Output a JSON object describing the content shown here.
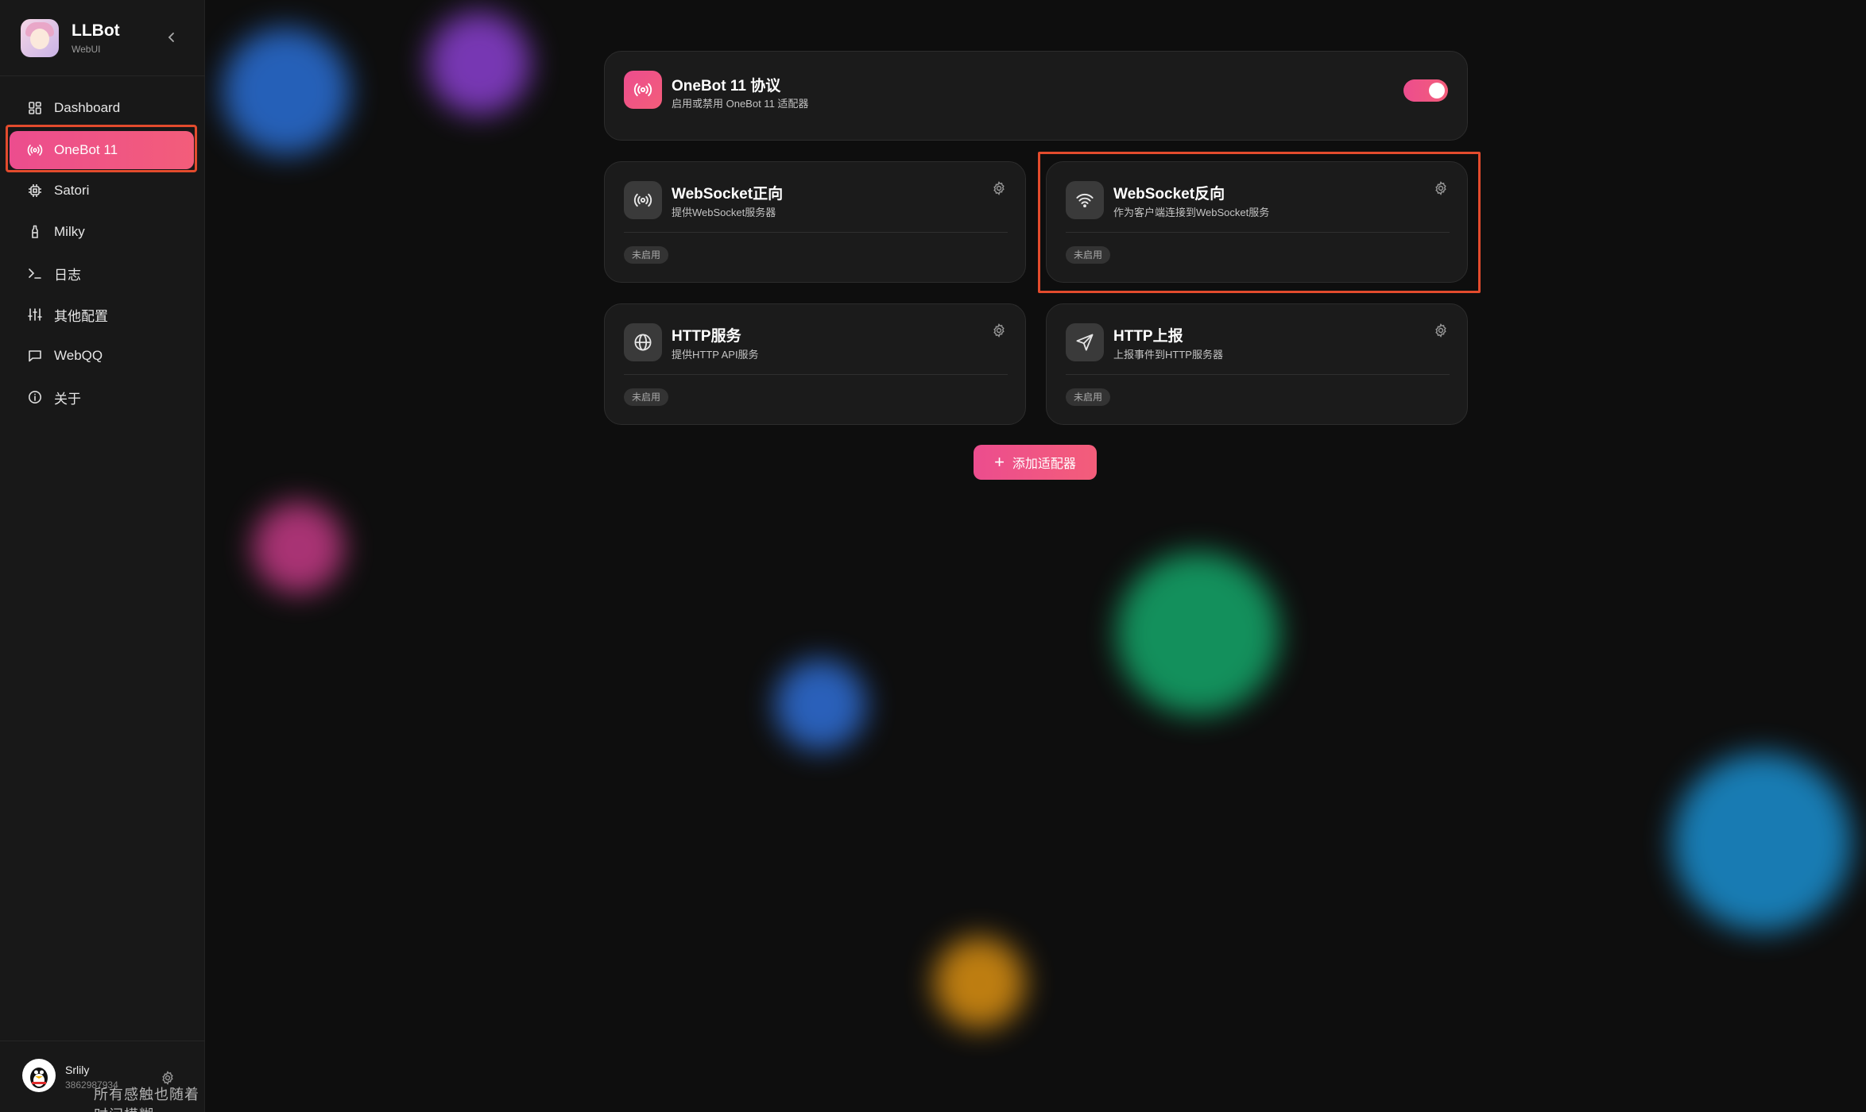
{
  "brand": {
    "title": "LLBot",
    "subtitle": "WebUI"
  },
  "sidebar": {
    "items": [
      {
        "label": "Dashboard",
        "icon": "dashboard-icon",
        "active": false
      },
      {
        "label": "OneBot 11",
        "icon": "broadcast-icon",
        "active": true
      },
      {
        "label": "Satori",
        "icon": "chip-icon",
        "active": false
      },
      {
        "label": "Milky",
        "icon": "bottle-icon",
        "active": false
      },
      {
        "label": "日志",
        "icon": "terminal-icon",
        "active": false
      },
      {
        "label": "其他配置",
        "icon": "sliders-icon",
        "active": false
      },
      {
        "label": "WebQQ",
        "icon": "message-icon",
        "active": false
      },
      {
        "label": "关于",
        "icon": "info-icon",
        "active": false
      }
    ]
  },
  "user": {
    "name": "Srlily",
    "id": "3862987934"
  },
  "watermark": "所有感触也随着时间模糊",
  "protocol": {
    "title": "OneBot 11 协议",
    "subtitle": "启用或禁用 OneBot 11 适配器",
    "enabled": true
  },
  "adapters": [
    {
      "title": "WebSocket正向",
      "subtitle": "提供WebSocket服务器",
      "status": "未启用",
      "icon": "broadcast-icon"
    },
    {
      "title": "WebSocket反向",
      "subtitle": "作为客户端连接到WebSocket服务",
      "status": "未启用",
      "icon": "wifi-icon"
    },
    {
      "title": "HTTP服务",
      "subtitle": "提供HTTP API服务",
      "status": "未启用",
      "icon": "globe-icon"
    },
    {
      "title": "HTTP上报",
      "subtitle": "上报事件到HTTP服务器",
      "status": "未启用",
      "icon": "send-icon"
    }
  ],
  "add_button": {
    "label": "添加适配器"
  },
  "colors": {
    "accent": "#ec4d8e",
    "highlight": "#e34b2d",
    "background": "#0e0e0e"
  }
}
